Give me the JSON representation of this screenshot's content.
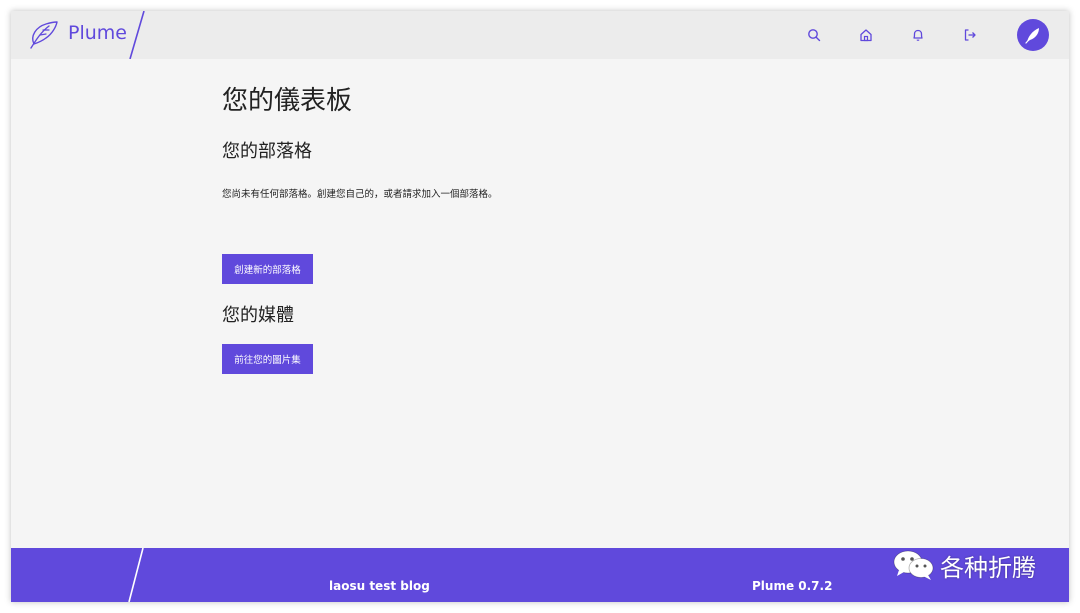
{
  "header": {
    "brand": "Plume",
    "nav_icons": [
      "search-icon",
      "home-icon",
      "bell-icon",
      "logout-icon"
    ],
    "avatar_icon": "feather-icon"
  },
  "main": {
    "page_title": "您的儀表板",
    "blogs": {
      "title": "您的部落格",
      "empty_text": "您尚未有任何部落格。創建您自己的，或者請求加入一個部落格。",
      "new_blog_button": "創建新的部落格"
    },
    "media": {
      "title": "您的媒體",
      "gallery_button": "前往您的圖片集"
    }
  },
  "footer": {
    "blog_name": "laosu test blog",
    "version": "Plume 0.7.2"
  },
  "watermark": {
    "text": "各种折腾",
    "icon": "wechat-icon"
  },
  "colors": {
    "accent": "#6049dc",
    "header_bg": "#ececec",
    "page_bg": "#f5f5f5"
  }
}
